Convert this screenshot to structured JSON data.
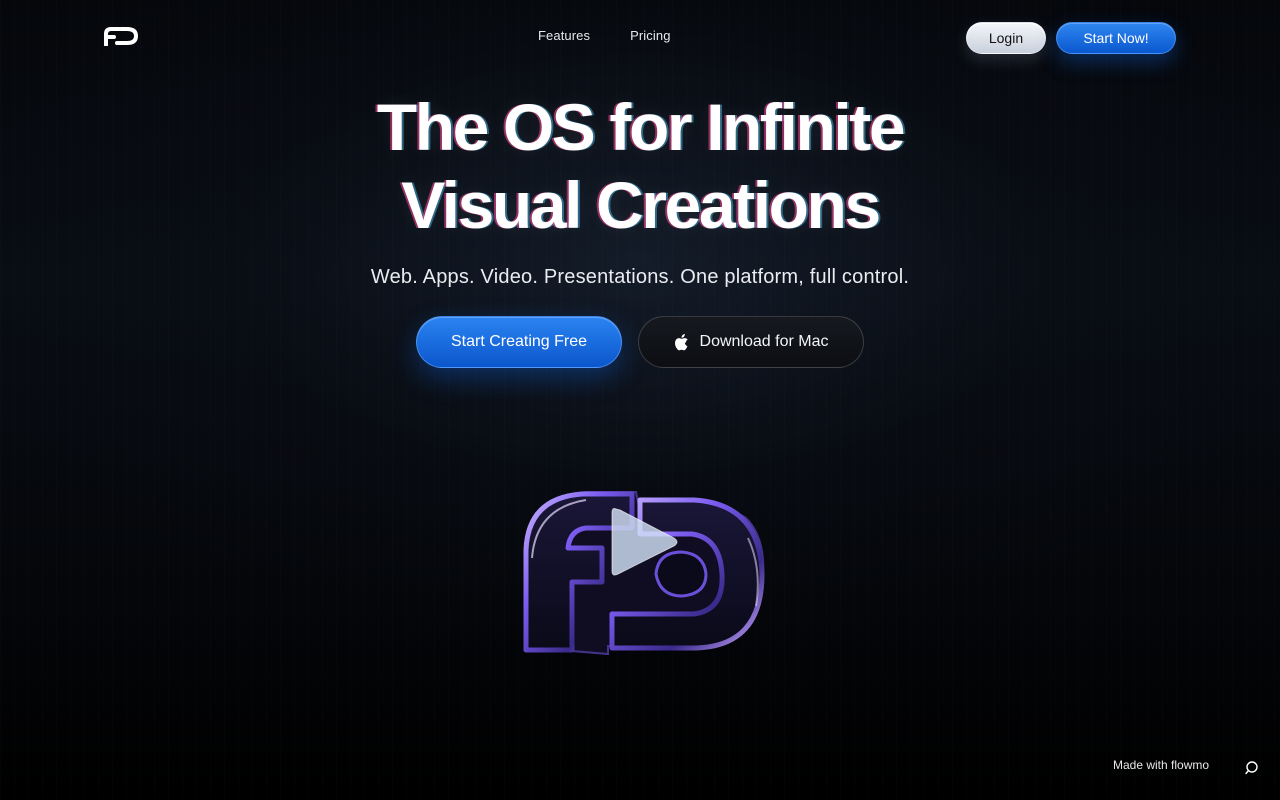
{
  "nav": {
    "logo_icon": "fd-logo-icon",
    "links": [
      {
        "label": "Features"
      },
      {
        "label": "Pricing"
      }
    ],
    "login_label": "Login",
    "start_label": "Start Now!"
  },
  "hero": {
    "title_line1": "The OS for Infinite",
    "title_line2": "Visual Creations",
    "subtitle": "Web. Apps. Video. Presentations. One platform, full control.",
    "cta_primary": "Start Creating Free",
    "cta_secondary": "Download for Mac",
    "cta_secondary_icon": "apple-icon"
  },
  "media": {
    "logo_3d_icon": "fd-3d-logo-icon",
    "play_icon": "play-icon"
  },
  "footer": {
    "made_with": "Made with flowmo",
    "chat_icon": "chat-bubble-icon"
  },
  "colors": {
    "accent": "#1a6fe6",
    "background": "#05070b",
    "logo_glow": "#8a5cff"
  }
}
